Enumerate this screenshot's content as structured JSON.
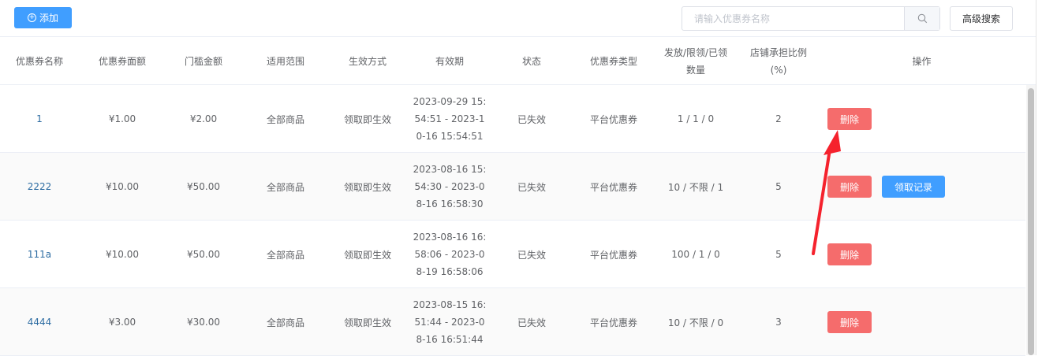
{
  "toolbar": {
    "add_label": "添加",
    "search_placeholder": "请输入优惠券名称",
    "advanced_search_label": "高级搜索"
  },
  "table": {
    "headers": {
      "name": "优惠券名称",
      "face_value": "优惠券面额",
      "threshold": "门槛金额",
      "scope": "适用范围",
      "effect_mode": "生效方式",
      "validity": "有效期",
      "status": "状态",
      "coupon_type": "优惠券类型",
      "quantity_l1": "发放/限领/已领",
      "quantity_l2": "数量",
      "ratio_l1": "店铺承担比例",
      "ratio_l2": "(%)",
      "actions": "操作"
    },
    "rows": [
      {
        "name": "1",
        "face_value": "¥1.00",
        "threshold": "¥2.00",
        "scope": "全部商品",
        "effect_mode": "领取即生效",
        "validity_l1": "2023-09-29 15:",
        "validity_l2": "54:51 - 2023-1",
        "validity_l3": "0-16 15:54:51",
        "status": "已失效",
        "coupon_type": "平台优惠券",
        "quantity": "1 / 1 / 0",
        "ratio": "2",
        "delete_label": "删除"
      },
      {
        "name": "2222",
        "face_value": "¥10.00",
        "threshold": "¥50.00",
        "scope": "全部商品",
        "effect_mode": "领取即生效",
        "validity_l1": "2023-08-16 15:",
        "validity_l2": "54:30 - 2023-0",
        "validity_l3": "8-16 16:58:30",
        "status": "已失效",
        "coupon_type": "平台优惠券",
        "quantity": "10 / 不限 / 1",
        "ratio": "5",
        "delete_label": "删除",
        "record_label": "领取记录"
      },
      {
        "name": "111a",
        "face_value": "¥10.00",
        "threshold": "¥50.00",
        "scope": "全部商品",
        "effect_mode": "领取即生效",
        "validity_l1": "2023-08-16 16:",
        "validity_l2": "58:06 - 2023-0",
        "validity_l3": "8-19 16:58:06",
        "status": "已失效",
        "coupon_type": "平台优惠券",
        "quantity": "100 / 1 / 0",
        "ratio": "5",
        "delete_label": "删除"
      },
      {
        "name": "4444",
        "face_value": "¥3.00",
        "threshold": "¥30.00",
        "scope": "全部商品",
        "effect_mode": "领取即生效",
        "validity_l1": "2023-08-15 16:",
        "validity_l2": "51:44 - 2023-0",
        "validity_l3": "8-16 16:51:44",
        "status": "已失效",
        "coupon_type": "平台优惠券",
        "quantity": "10 / 不限 / 0",
        "ratio": "3",
        "delete_label": "删除"
      }
    ]
  },
  "icons": {
    "add": "plus-circle-icon",
    "search": "search-icon",
    "annotation": "red-arrow-annotation"
  },
  "colors": {
    "primary": "#409eff",
    "danger": "#f56c6c",
    "link": "#2d6ca2",
    "annotation": "#f5222d"
  }
}
